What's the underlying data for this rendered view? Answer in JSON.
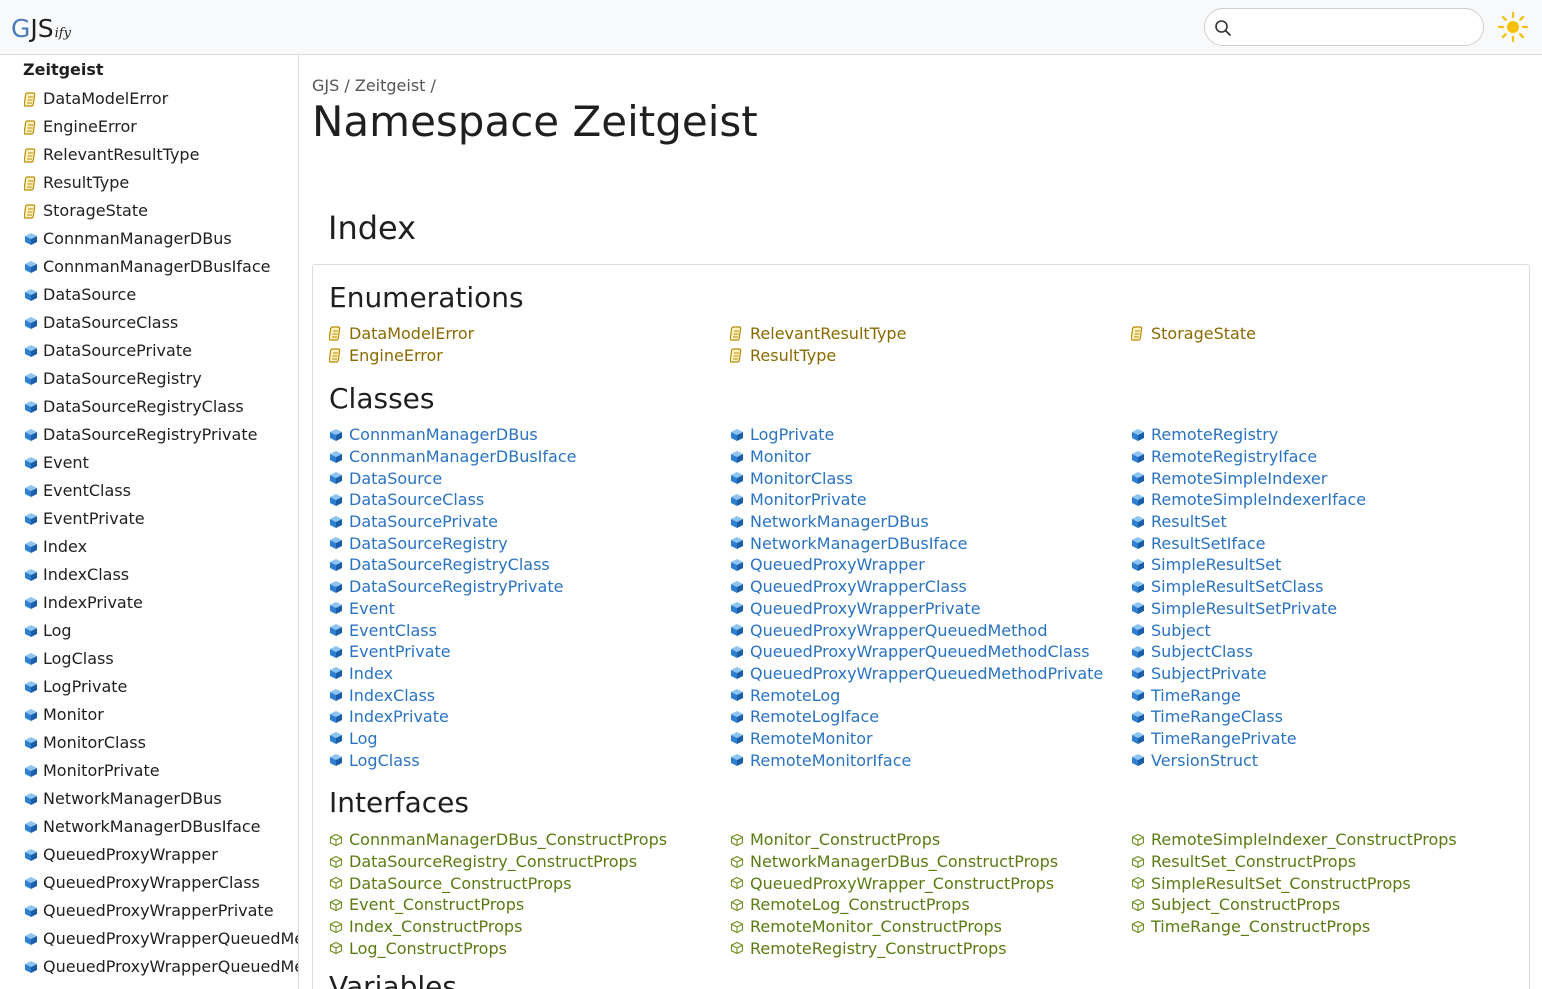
{
  "header": {
    "logo_g": "G",
    "logo_js": "JS",
    "logo_ify": "ify",
    "search_placeholder": "",
    "search_icon": "search-icon",
    "theme_icon": "sun-icon"
  },
  "colors": {
    "enum": "#8a6a00",
    "class": "#2a73c2",
    "interface": "#5b7a12",
    "sun": "#f5c000"
  },
  "sidebar": {
    "title": "Zeitgeist",
    "items": [
      {
        "label": "DataModelError",
        "kind": "enum"
      },
      {
        "label": "EngineError",
        "kind": "enum"
      },
      {
        "label": "RelevantResultType",
        "kind": "enum"
      },
      {
        "label": "ResultType",
        "kind": "enum"
      },
      {
        "label": "StorageState",
        "kind": "enum"
      },
      {
        "label": "ConnmanManagerDBus",
        "kind": "class"
      },
      {
        "label": "ConnmanManagerDBusIface",
        "kind": "class"
      },
      {
        "label": "DataSource",
        "kind": "class"
      },
      {
        "label": "DataSourceClass",
        "kind": "class"
      },
      {
        "label": "DataSourcePrivate",
        "kind": "class"
      },
      {
        "label": "DataSourceRegistry",
        "kind": "class"
      },
      {
        "label": "DataSourceRegistryClass",
        "kind": "class"
      },
      {
        "label": "DataSourceRegistryPrivate",
        "kind": "class"
      },
      {
        "label": "Event",
        "kind": "class"
      },
      {
        "label": "EventClass",
        "kind": "class"
      },
      {
        "label": "EventPrivate",
        "kind": "class"
      },
      {
        "label": "Index",
        "kind": "class"
      },
      {
        "label": "IndexClass",
        "kind": "class"
      },
      {
        "label": "IndexPrivate",
        "kind": "class"
      },
      {
        "label": "Log",
        "kind": "class"
      },
      {
        "label": "LogClass",
        "kind": "class"
      },
      {
        "label": "LogPrivate",
        "kind": "class"
      },
      {
        "label": "Monitor",
        "kind": "class"
      },
      {
        "label": "MonitorClass",
        "kind": "class"
      },
      {
        "label": "MonitorPrivate",
        "kind": "class"
      },
      {
        "label": "NetworkManagerDBus",
        "kind": "class"
      },
      {
        "label": "NetworkManagerDBusIface",
        "kind": "class"
      },
      {
        "label": "QueuedProxyWrapper",
        "kind": "class"
      },
      {
        "label": "QueuedProxyWrapperClass",
        "kind": "class"
      },
      {
        "label": "QueuedProxyWrapperPrivate",
        "kind": "class"
      },
      {
        "label": "QueuedProxyWrapperQueuedMethod",
        "kind": "class"
      },
      {
        "label": "QueuedProxyWrapperQueuedMethodClass",
        "kind": "class"
      }
    ]
  },
  "main": {
    "breadcrumb": [
      "GJS",
      "Zeitgeist"
    ],
    "breadcrumb_sep": "/",
    "title": "Namespace Zeitgeist",
    "index_title": "Index",
    "sections": {
      "enumerations": {
        "title": "Enumerations",
        "columns": [
          [
            "DataModelError",
            "EngineError"
          ],
          [
            "RelevantResultType",
            "ResultType"
          ],
          [
            "StorageState"
          ]
        ]
      },
      "classes": {
        "title": "Classes",
        "columns": [
          [
            "ConnmanManagerDBus",
            "ConnmanManagerDBusIface",
            "DataSource",
            "DataSourceClass",
            "DataSourcePrivate",
            "DataSourceRegistry",
            "DataSourceRegistryClass",
            "DataSourceRegistryPrivate",
            "Event",
            "EventClass",
            "EventPrivate",
            "Index",
            "IndexClass",
            "IndexPrivate",
            "Log",
            "LogClass"
          ],
          [
            "LogPrivate",
            "Monitor",
            "MonitorClass",
            "MonitorPrivate",
            "NetworkManagerDBus",
            "NetworkManagerDBusIface",
            "QueuedProxyWrapper",
            "QueuedProxyWrapperClass",
            "QueuedProxyWrapperPrivate",
            "QueuedProxyWrapperQueuedMethod",
            "QueuedProxyWrapperQueuedMethodClass",
            "QueuedProxyWrapperQueuedMethodPrivate",
            "RemoteLog",
            "RemoteLogIface",
            "RemoteMonitor",
            "RemoteMonitorIface"
          ],
          [
            "RemoteRegistry",
            "RemoteRegistryIface",
            "RemoteSimpleIndexer",
            "RemoteSimpleIndexerIface",
            "ResultSet",
            "ResultSetIface",
            "SimpleResultSet",
            "SimpleResultSetClass",
            "SimpleResultSetPrivate",
            "Subject",
            "SubjectClass",
            "SubjectPrivate",
            "TimeRange",
            "TimeRangeClass",
            "TimeRangePrivate",
            "VersionStruct"
          ]
        ]
      },
      "interfaces": {
        "title": "Interfaces",
        "columns": [
          [
            "ConnmanManagerDBus_ConstructProps",
            "DataSourceRegistry_ConstructProps",
            "DataSource_ConstructProps",
            "Event_ConstructProps",
            "Index_ConstructProps",
            "Log_ConstructProps"
          ],
          [
            "Monitor_ConstructProps",
            "NetworkManagerDBus_ConstructProps",
            "QueuedProxyWrapper_ConstructProps",
            "RemoteLog_ConstructProps",
            "RemoteMonitor_ConstructProps",
            "RemoteRegistry_ConstructProps"
          ],
          [
            "RemoteSimpleIndexer_ConstructProps",
            "ResultSet_ConstructProps",
            "SimpleResultSet_ConstructProps",
            "Subject_ConstructProps",
            "TimeRange_ConstructProps"
          ]
        ]
      },
      "variables": {
        "title": "Variables"
      }
    }
  }
}
